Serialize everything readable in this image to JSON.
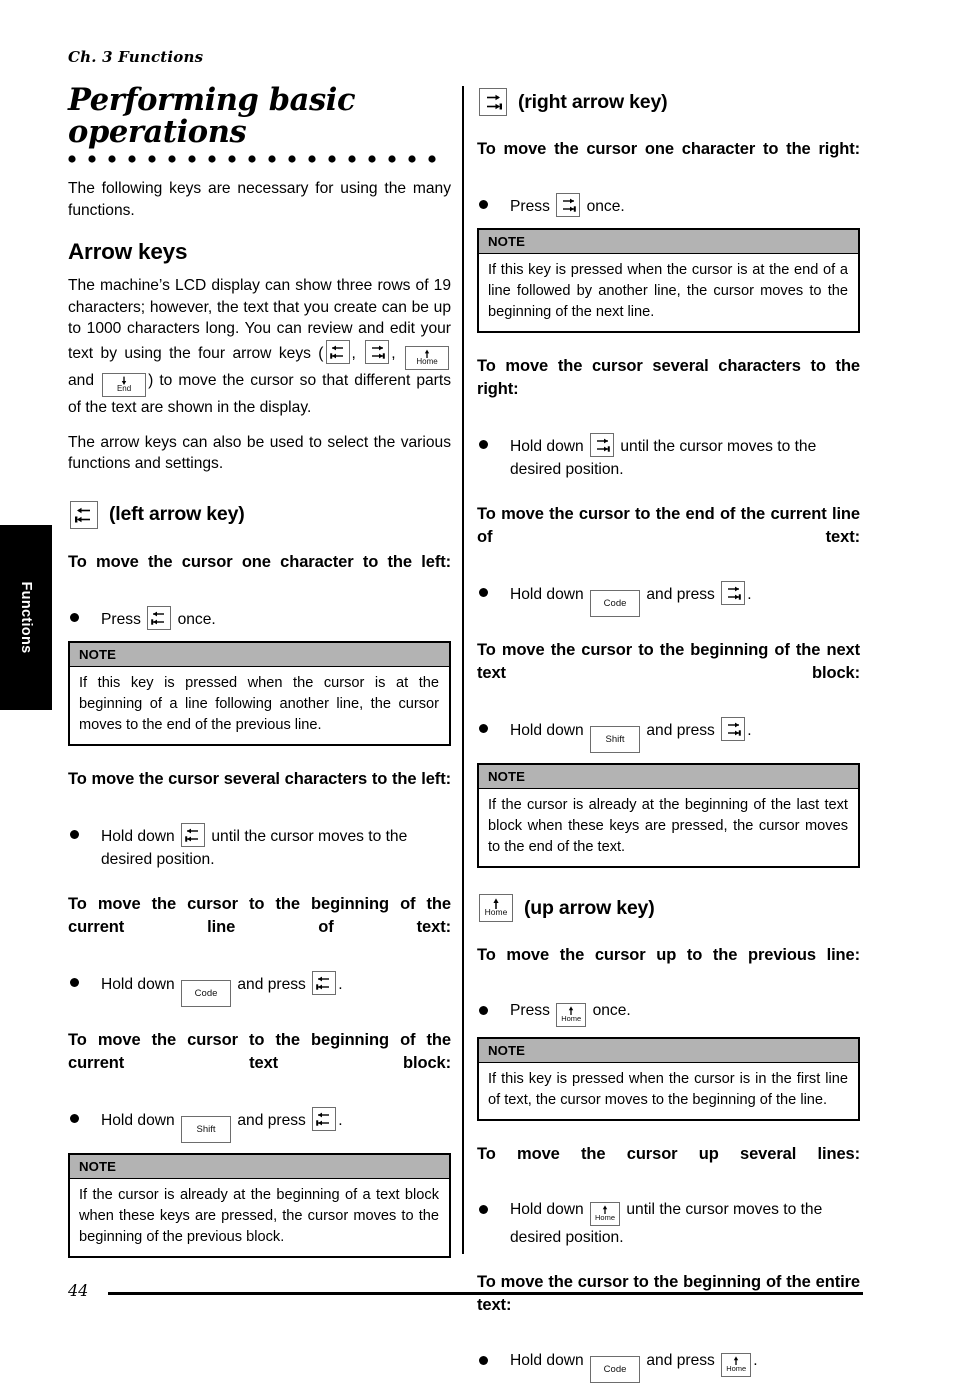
{
  "page": {
    "running_head": "Ch. 3 Functions",
    "folio": "44",
    "side_tab_label": "Functions"
  },
  "left_column": {
    "chapter_title": "Performing basic operations",
    "intro": "The following keys are necessary for using the many functions.",
    "section_heading": "Arrow keys",
    "paragraph_1_a": "The machine’s LCD display can show three rows of 19 characters; however, the text that you create can be up to 1000 characters long. You can review and edit your text by using the four arrow keys (",
    "paragraph_1_b": ", ",
    "paragraph_1_c": ", ",
    "paragraph_1_d": " and ",
    "paragraph_1_e": ") to move the cursor so that different parts of the text are shown in the display.",
    "paragraph_2": "The arrow keys can also be used to select the various functions and settings.",
    "key_heading": "(left arrow key)",
    "sub_1": "To move the cursor one character to the left:",
    "bullet_1_pre": "Press",
    "bullet_1_post": "once.",
    "note_1": {
      "title": "NOTE",
      "body": "If this key is pressed when the cursor is at the beginning of a line following another line, the cursor moves to the end of the previous line."
    },
    "sub_2": "To move the cursor several characters to the left:",
    "bullet_2_pre": "Hold down",
    "bullet_2_post": "until the cursor moves to the desired position.",
    "sub_3": "To move the cursor to the beginning of the current line of text:",
    "bullet_3_pre": "Hold down",
    "bullet_3_mid": "and press",
    "bullet_3_post": ".",
    "sub_4": "To move the cursor to the beginning of the current text block:",
    "bullet_4_pre": "Hold down",
    "bullet_4_mid": "and press",
    "bullet_4_post": ".",
    "note_2": {
      "title": "NOTE",
      "body": "If the cursor is already at the beginning of a text block when these keys are pressed, the cursor moves to the beginning of the previous block."
    }
  },
  "right_column": {
    "key_heading_right": "(right arrow key)",
    "sub_1": "To move the cursor one character to the right:",
    "bullet_1_pre": "Press",
    "bullet_1_post": "once.",
    "note_1": {
      "title": "NOTE",
      "body": "If this key is pressed when the cursor is at the end of a line followed by another line, the cursor moves to the beginning of the next line."
    },
    "sub_2": "To move the cursor several characters to the right:",
    "bullet_2_pre": "Hold down",
    "bullet_2_post": "until the cursor moves to the desired position.",
    "sub_3": "To move the cursor to the end of the current line of text:",
    "bullet_3_pre": "Hold down",
    "bullet_3_mid": "and press",
    "bullet_3_post": ".",
    "sub_4": "To move the cursor to the beginning of the next text block:",
    "bullet_4_pre": "Hold down",
    "bullet_4_mid": "and press",
    "bullet_4_post": ".",
    "note_2": {
      "title": "NOTE",
      "body": "If the cursor is already at the beginning of the last text block when these keys are pressed, the cursor moves to the end of the text."
    },
    "key_heading_up": "(up arrow key)",
    "sub_5": "To move the cursor up to the previous line:",
    "bullet_5_pre": "Press",
    "bullet_5_post": "once.",
    "note_3": {
      "title": "NOTE",
      "body": "If this key is pressed when the cursor is in the first line of text, the cursor moves to the beginning of the line."
    },
    "sub_6": "To move the cursor up several lines:",
    "bullet_6_pre": "Hold down",
    "bullet_6_post": "until the cursor moves to the desired position.",
    "sub_7": "To move the cursor to the beginning of the entire text:",
    "bullet_7_pre": "Hold down",
    "bullet_7_mid": "and press",
    "bullet_7_post": "."
  },
  "keys": {
    "left_arrow": "left-arrow-key",
    "right_arrow": "right-arrow-key",
    "up_arrow_home": "Home",
    "down_arrow_end": "End",
    "code": "Code",
    "shift": "Shift"
  },
  "colors": {
    "note_header_bg": "#b3b3b3",
    "ink": "#000000",
    "keycap_border": "#6d6d6d",
    "paper": "#ffffff"
  }
}
